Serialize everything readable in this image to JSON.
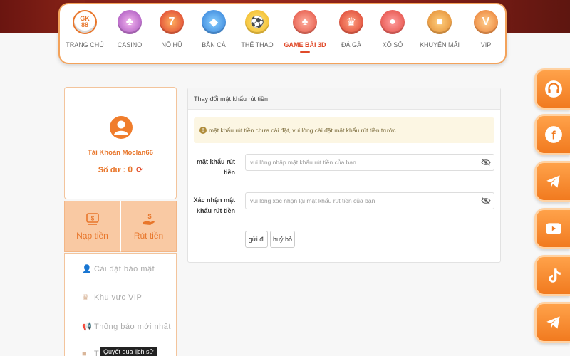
{
  "nav": {
    "items": [
      {
        "label": "TRANG CHỦ",
        "icon": "gk88-logo-icon",
        "badge": "GK\n88",
        "color": "#e8762b"
      },
      {
        "label": "CASINO",
        "icon": "casino-chip-icon",
        "badge": "♣",
        "color": "#b05ac0"
      },
      {
        "label": "NỔ HŨ",
        "icon": "slot-777-icon",
        "badge": "7",
        "color": "#d8342a"
      },
      {
        "label": "BẮN CÁ",
        "icon": "fish-icon",
        "badge": "◆",
        "color": "#2e7bd6"
      },
      {
        "label": "THỂ THAO",
        "icon": "soccer-ball-icon",
        "badge": "⚽",
        "color": "#f0b41c"
      },
      {
        "label": "GAME BÀI 3D",
        "icon": "cards-icon",
        "badge": "♠",
        "color": "#e04a3a",
        "active": true
      },
      {
        "label": "ĐÁ GÀ",
        "icon": "rooster-icon",
        "badge": "♛",
        "color": "#d83a2a"
      },
      {
        "label": "XỔ SỐ",
        "icon": "lottery-ball-icon",
        "badge": "●",
        "color": "#e0433a"
      },
      {
        "label": "KHUYẾN MÃI",
        "icon": "gift-box-icon",
        "badge": "■",
        "color": "#e0862a"
      },
      {
        "label": "VIP",
        "icon": "vip-badge-icon",
        "badge": "V",
        "color": "#e8762b"
      }
    ]
  },
  "profile": {
    "account_label": "Tài Khoản Moclan66",
    "balance_label": "Số dư :",
    "balance_value": "0"
  },
  "actions": {
    "deposit": "Nạp tiền",
    "withdraw": "Rút tiền"
  },
  "side_menu": {
    "items": [
      {
        "label": "Cài đặt bảo mật",
        "icon": "user-lock-icon"
      },
      {
        "label": "Khu vực VIP",
        "icon": "crown-icon"
      },
      {
        "label": "Thông báo mới nhất",
        "icon": "megaphone-icon"
      },
      {
        "label": "Th",
        "icon": "history-icon"
      }
    ],
    "tooltip": "Quyết qua lịch sử"
  },
  "panel": {
    "title": "Thay đổi mật khẩu rút tiền",
    "alert": "mật khẩu rút tiền chưa cài đặt, vui lòng cài đặt mật khẩu rút tiền trước",
    "field1_label": "mật khẩu rút tiền",
    "field1_placeholder": "vui lòng nhập mật khẩu rút tiền của bạn",
    "field2_label": "Xác nhận mật khẩu rút tiền",
    "field2_placeholder": "vui lòng xác nhận lại mật khẩu rút tiền của bạn",
    "submit_label": "gửi đi",
    "cancel_label": "huỷ bỏ"
  },
  "social": [
    {
      "name": "support-headset-icon"
    },
    {
      "name": "facebook-icon"
    },
    {
      "name": "telegram-icon"
    },
    {
      "name": "youtube-icon"
    },
    {
      "name": "tiktok-icon"
    },
    {
      "name": "telegram-channel-icon"
    }
  ],
  "colors": {
    "accent": "#e8762b",
    "active_nav": "#e04a2a",
    "alert_bg": "#fcf6e3"
  }
}
